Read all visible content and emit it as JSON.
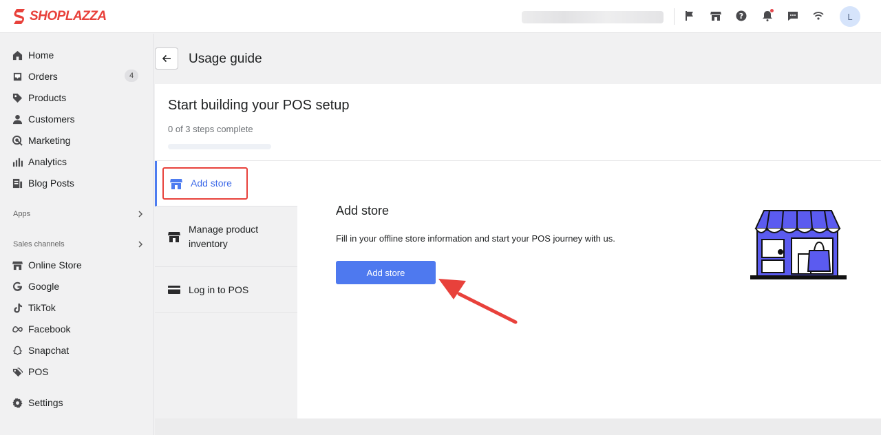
{
  "brand": {
    "name": "SHOPLAZZA",
    "color": "#e8413b"
  },
  "topbar": {
    "icons": [
      "flag-icon",
      "store-icon",
      "help-icon",
      "bell-icon",
      "chat-icon",
      "wifi-icon"
    ],
    "avatar_initial": "L"
  },
  "sidebar": {
    "items": [
      {
        "label": "Home",
        "icon": "home-icon"
      },
      {
        "label": "Orders",
        "icon": "inbox-icon",
        "badge": "4"
      },
      {
        "label": "Products",
        "icon": "tag-icon"
      },
      {
        "label": "Customers",
        "icon": "person-icon"
      },
      {
        "label": "Marketing",
        "icon": "target-icon"
      },
      {
        "label": "Analytics",
        "icon": "bar-chart-icon"
      },
      {
        "label": "Blog Posts",
        "icon": "document-icon"
      }
    ],
    "apps_label": "Apps",
    "sales_channels_label": "Sales channels",
    "channels": [
      {
        "label": "Online Store",
        "icon": "storefront-icon"
      },
      {
        "label": "Google",
        "icon": "google-icon"
      },
      {
        "label": "TikTok",
        "icon": "tiktok-icon"
      },
      {
        "label": "Facebook",
        "icon": "meta-icon"
      },
      {
        "label": "Snapchat",
        "icon": "ghost-icon"
      },
      {
        "label": "POS",
        "icon": "tags-icon"
      }
    ],
    "settings_label": "Settings"
  },
  "header": {
    "title": "Usage guide"
  },
  "setup": {
    "title": "Start building your POS setup",
    "progress_text": "0 of 3 steps complete",
    "progress_fraction": 0,
    "steps": [
      {
        "label": "Add store",
        "icon": "store-icon",
        "active": true
      },
      {
        "label": "Manage product inventory",
        "icon": "store-icon",
        "active": false
      },
      {
        "label": "Log in to POS",
        "icon": "card-icon",
        "active": false
      }
    ],
    "detail": {
      "title": "Add store",
      "description": "Fill in your offline store information and start your POS journey with us.",
      "button_label": "Add store"
    }
  },
  "colors": {
    "accent": "#4e79ef",
    "annotation": "#e8413b"
  }
}
